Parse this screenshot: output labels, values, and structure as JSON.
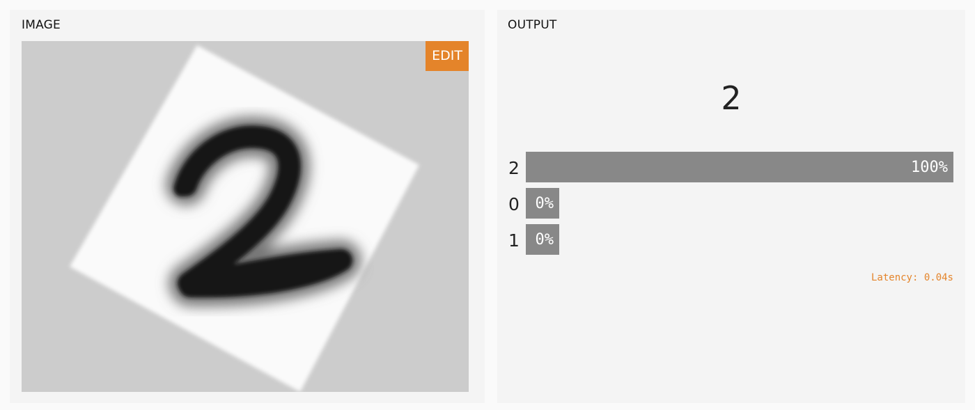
{
  "image_panel": {
    "title": "IMAGE",
    "edit_label": "EDIT",
    "image_content": "handwritten digit 2 on rotated white square"
  },
  "output_panel": {
    "title": "OUTPUT",
    "prediction": "2",
    "bars": [
      {
        "label": "2",
        "value_text": "100%",
        "fraction": 1.0
      },
      {
        "label": "0",
        "value_text": "0%",
        "fraction": 0.0
      },
      {
        "label": "1",
        "value_text": "0%",
        "fraction": 0.0
      }
    ],
    "latency": "Latency: 0.04s"
  },
  "colors": {
    "accent": "#e4842a",
    "bar": "#888888",
    "image_background": "#cccccc",
    "panel_background": "#f4f4f4"
  }
}
